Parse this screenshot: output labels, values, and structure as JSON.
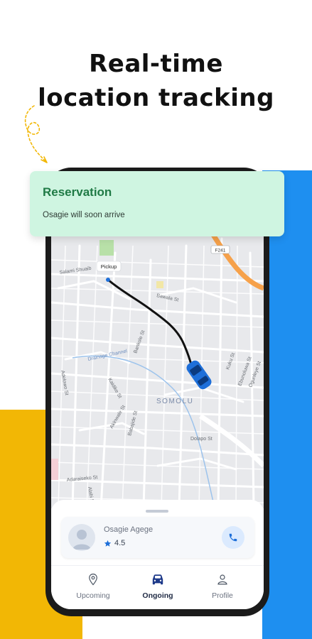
{
  "headline": {
    "line1": "Real-time",
    "line2": "location tracking"
  },
  "notification": {
    "title": "Reservation",
    "message": "Osagie will soon arrive"
  },
  "map": {
    "pickup_label": "Pickup",
    "area_label": "SOMOLU",
    "badge": "F241",
    "streets": [
      "Salami Shuaib",
      "Bawala St",
      "Bankole St",
      "Drainage Channel",
      "Kuku St",
      "Ebunoluwa St",
      "Ogunleye St",
      "Kaidike St",
      "Adelowo St",
      "Akinwale St",
      "Babajide St",
      "Dolapo St",
      "Adaraiseko St",
      "Alabi St"
    ]
  },
  "driver": {
    "name": "Osagie Agege",
    "rating": "4.5"
  },
  "tabs": [
    {
      "label": "Upcoming",
      "icon": "location-pin-icon"
    },
    {
      "label": "Ongoing",
      "icon": "car-icon"
    },
    {
      "label": "Profile",
      "icon": "user-icon"
    }
  ],
  "colors": {
    "yellow": "#f2b705",
    "blue": "#1e8ff0",
    "notification_bg": "#cff5e1",
    "notification_title": "#1f7a45",
    "car": "#1e6fd9"
  }
}
